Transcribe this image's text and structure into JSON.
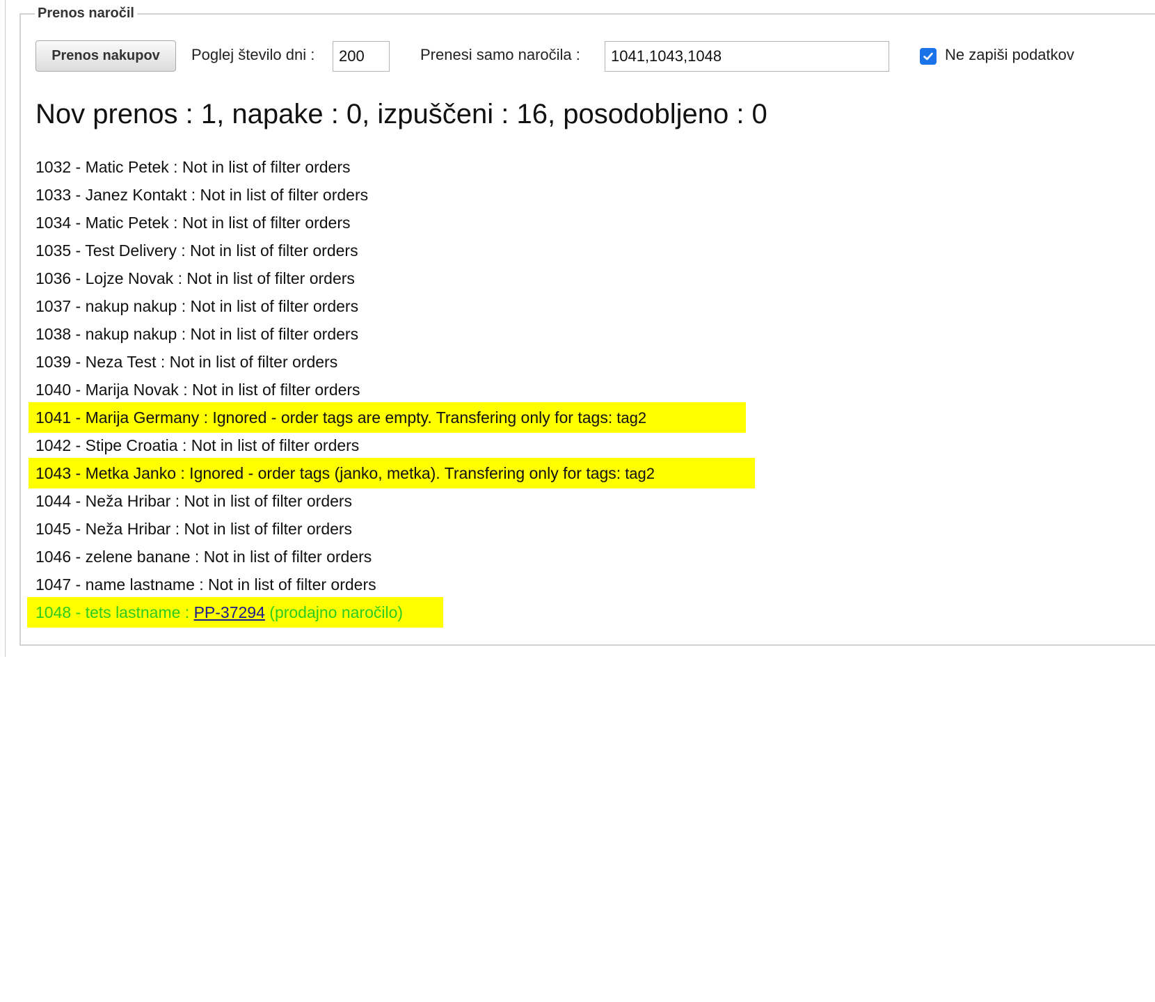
{
  "panel": {
    "legend": "Prenos naročil",
    "button_label": "Prenos nakupov",
    "days_label": "Poglej število dni :",
    "days_value": "200",
    "orders_label": "Prenesi samo naročila :",
    "orders_value": "1041,1043,1048",
    "no_write_label": "Ne zapiši podatkov",
    "no_write_checked": true,
    "accent_color": "#1a73e8",
    "highlight_color": "#ffff00",
    "success_color": "#2ecc1e"
  },
  "summary": "Nov prenos : 1, napake : 0, izpuščeni : 16, posodobljeno : 0",
  "log": {
    "rows": [
      "1032 - Matic Petek : Not in list of filter orders",
      "1033 - Janez Kontakt : Not in list of filter orders",
      "1034 - Matic Petek : Not in list of filter orders",
      "1035 - Test Delivery : Not in list of filter orders",
      "1036 - Lojze Novak : Not in list of filter orders",
      "1037 - nakup nakup : Not in list of filter orders",
      "1038 - nakup nakup : Not in list of filter orders",
      "1039 - Neza Test : Not in list of filter orders",
      "1040 - Marija Novak : Not in list of filter orders"
    ],
    "row_1041": {
      "text": "1041 - Marija Germany : Ignored - order tags are empty. Transfering only for tags:",
      "tag": "tag2"
    },
    "row_1042": "1042 - Stipe Croatia : Not in list of filter orders",
    "row_1043": {
      "text": "1043 - Metka Janko : Ignored - order tags (janko, metka). Transfering only for tags:",
      "tag": "tag2"
    },
    "rows_after": [
      "1044 - Neža Hribar : Not in list of filter orders",
      "1045 - Neža Hribar : Not in list of filter orders",
      "1046 - zelene banane : Not in list of filter orders",
      "1047 - name lastname : Not in list of filter orders"
    ],
    "row_1048": {
      "prefix": "1048 - tets lastname :",
      "link": "PP-37294",
      "suffix": "(prodajno naročilo)"
    }
  }
}
